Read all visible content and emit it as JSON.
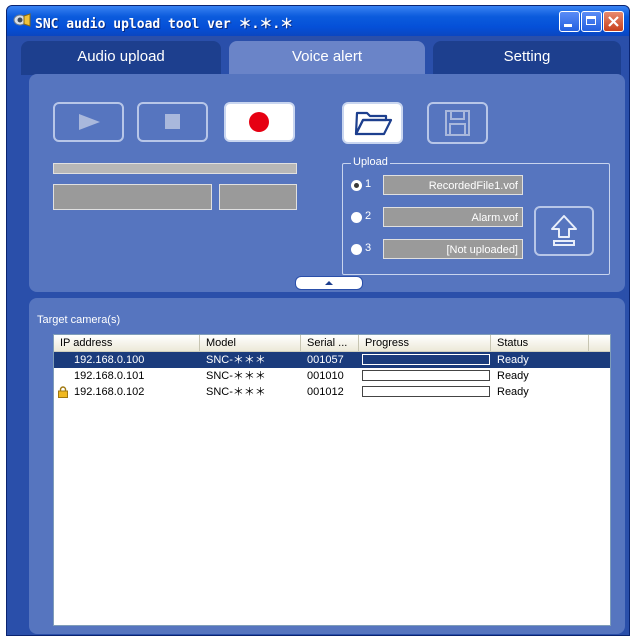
{
  "window": {
    "title": "SNC audio upload tool ver ＊.＊.＊"
  },
  "tabs": [
    {
      "label": "Audio upload"
    },
    {
      "label": "Voice alert",
      "active": true
    },
    {
      "label": "Setting"
    }
  ],
  "media_controls": [
    {
      "name": "play-icon",
      "enabled": false
    },
    {
      "name": "stop-icon",
      "enabled": false
    },
    {
      "name": "record-icon",
      "enabled": true
    }
  ],
  "file_controls": [
    {
      "name": "open-folder-icon",
      "enabled": true
    },
    {
      "name": "save-icon",
      "enabled": false
    }
  ],
  "upload": {
    "legend": "Upload",
    "slots": [
      {
        "num": "1",
        "value": "RecordedFile1.vof",
        "selected": true
      },
      {
        "num": "2",
        "value": "Alarm.vof",
        "selected": false
      },
      {
        "num": "3",
        "value": "[Not uploaded]",
        "selected": false
      }
    ],
    "button_icon": "upload-arrow-icon"
  },
  "targets": {
    "label": "Target camera(s)",
    "columns": [
      "IP address",
      "Model",
      "Serial ...",
      "Progress",
      "Status"
    ],
    "rows": [
      {
        "ip": "192.168.0.100",
        "model": "SNC-＊＊＊",
        "serial": "001057",
        "progress": 0,
        "status": "Ready",
        "selected": true,
        "locked": false
      },
      {
        "ip": "192.168.0.101",
        "model": "SNC-＊＊＊",
        "serial": "001010",
        "progress": 0,
        "status": "Ready",
        "selected": false,
        "locked": false
      },
      {
        "ip": "192.168.0.102",
        "model": "SNC-＊＊＊",
        "serial": "001012",
        "progress": 0,
        "status": "Ready",
        "selected": false,
        "locked": true
      }
    ]
  },
  "colors": {
    "window_bg": "#2a4faa",
    "panel": "#5675bf",
    "selected_row": "#1a3b7c",
    "record": "#e60012"
  }
}
